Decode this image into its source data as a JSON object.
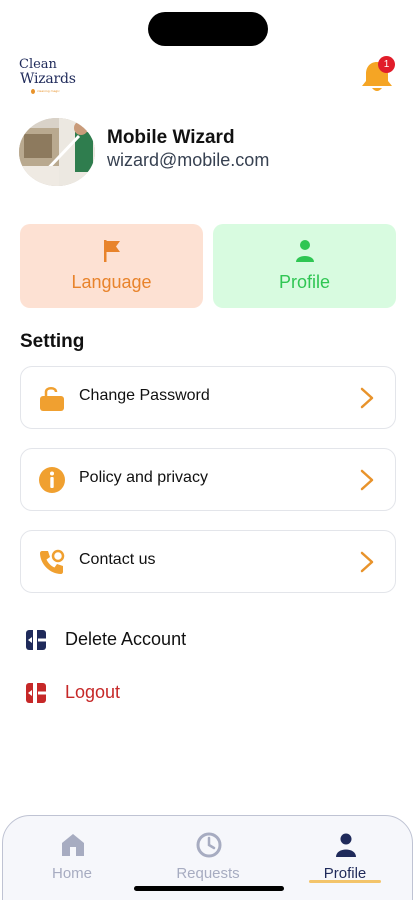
{
  "app": {
    "logo_line1": "Clean",
    "logo_line2": "Wizards",
    "logo_tagline": "cleaning magic"
  },
  "header": {
    "notification_count": "1"
  },
  "user": {
    "name": "Mobile Wizard",
    "email": "wizard@mobile.com"
  },
  "quick_cards": [
    {
      "label": "Language",
      "icon": "flag-icon",
      "color": "#e8832b",
      "background": "#fde1d3"
    },
    {
      "label": "Profile",
      "icon": "user-icon",
      "color": "#2fc653",
      "background": "#d8fbe0"
    }
  ],
  "settings": {
    "title": "Setting",
    "items": [
      {
        "label": "Change Password",
        "icon": "unlock-icon"
      },
      {
        "label": "Policy and privacy",
        "icon": "info-icon"
      },
      {
        "label": "Contact us",
        "icon": "phone-icon"
      }
    ]
  },
  "account_actions": [
    {
      "label": "Delete Account",
      "icon": "exit-icon",
      "color": "#1f2a5a"
    },
    {
      "label": "Logout",
      "icon": "logout-icon",
      "color": "#c62828"
    }
  ],
  "tabbar": {
    "items": [
      {
        "label": "Home",
        "icon": "home-icon",
        "active": false
      },
      {
        "label": "Requests",
        "icon": "clock-icon",
        "active": false
      },
      {
        "label": "Profile",
        "icon": "user-icon",
        "active": true
      }
    ]
  },
  "colors": {
    "accent": "#e8932b",
    "brand_dark": "#1f2a5a",
    "danger": "#c62828",
    "badge": "#e11d2a"
  }
}
